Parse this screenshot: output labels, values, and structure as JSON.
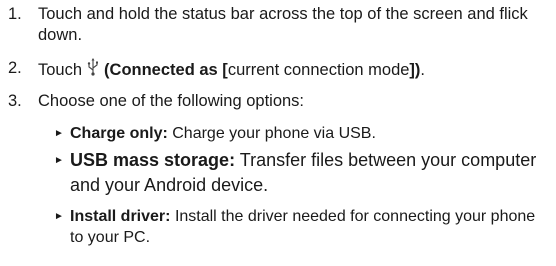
{
  "steps": [
    {
      "number": "1.",
      "text": "Touch and hold the status bar across the top of the screen and flick down."
    },
    {
      "number": "2.",
      "prefix": "Touch",
      "icon": "usb-icon",
      "open_paren": "(",
      "bold_a": "Connected as [",
      "plain": "current connection mode",
      "bold_b": "])",
      "period": "."
    },
    {
      "number": "3.",
      "text": "Choose one of the following options:"
    }
  ],
  "options": [
    {
      "label": "Charge only:",
      "desc": "Charge your phone via USB."
    },
    {
      "label": "USB mass storage:",
      "desc": "Transfer files between your computer and your Android device."
    },
    {
      "label": "Install driver:",
      "desc": "Install the driver needed for connecting your phone to your PC."
    }
  ],
  "bullet_glyph": "►"
}
